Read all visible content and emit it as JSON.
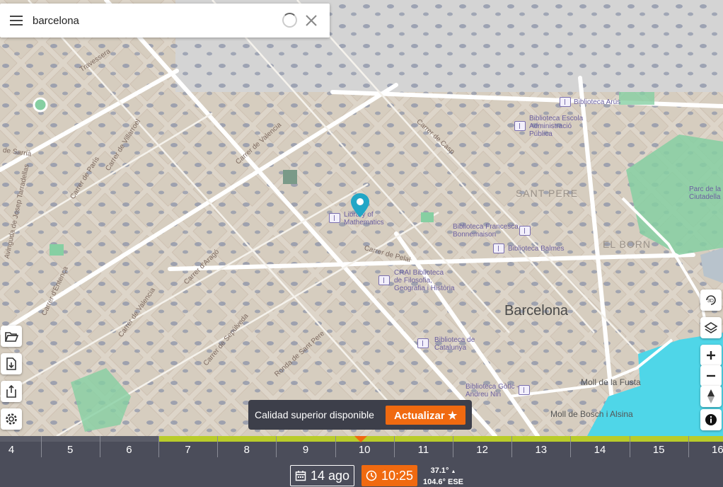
{
  "search": {
    "value": "barcelona"
  },
  "icons": {
    "menu": "menu-icon",
    "spinner": "loading-spinner-icon",
    "clear": "close-icon",
    "folder": "folder-open-icon",
    "file_download": "file-download-icon",
    "share": "share-icon",
    "settings": "gear-icon",
    "threed": "3d-view-icon",
    "layers": "layers-icon",
    "zoom_in": "plus-icon",
    "zoom_out": "minus-icon",
    "compass": "compass-icon",
    "info": "info-icon",
    "calendar": "calendar-icon",
    "clock": "clock-icon",
    "pin": "location-pin-icon"
  },
  "map": {
    "city": "Barcelona",
    "districts": [
      "SANT PERE",
      "EL BORN"
    ],
    "pois": [
      "Biblioteca Arús",
      "Biblioteca Escola\nAdministració\nPública",
      "Library of\nMathematics",
      "Biblioteca Francesca\nBonnemaison",
      "Biblioteca Balmes",
      "CRAI Biblioteca\nde Filosofia,\nGeografia i Història",
      "Biblioteca de\nCatalunya",
      "Biblioteca Gòtic -\nAndreu Nin",
      "Parc de la\nCiutadella",
      "Moll de la Fusta",
      "Moll de Bosch i Alsina"
    ],
    "streets": [
      "Travessera",
      "Carrer de Villarroel",
      "Carrer de París",
      "Carrer de Valencia",
      "Carrer de Pelai",
      "Carrer de Casp",
      "Ronda de Sant Pere",
      "Carrer de Sepúlveda",
      "Carrer d'Aragó",
      "Carrer d'Entença",
      "Avinguda de Josep Tarradellas",
      "Carrer de Valencia",
      "de Sarrià"
    ]
  },
  "toast": {
    "message": "Calidad superior disponible",
    "button": "Actualizar ★"
  },
  "timeline": {
    "hours": [
      "4",
      "5",
      "6",
      "7",
      "8",
      "9",
      "10",
      "11",
      "12",
      "13",
      "14",
      "15",
      "16"
    ],
    "date": "14 ago",
    "time": "10:25",
    "lat": "37.1°",
    "lon": "104.6° ESE",
    "colors": {
      "progress": "#b9cc2a",
      "accent": "#f06a10",
      "bar": "#4b4d5a"
    }
  }
}
